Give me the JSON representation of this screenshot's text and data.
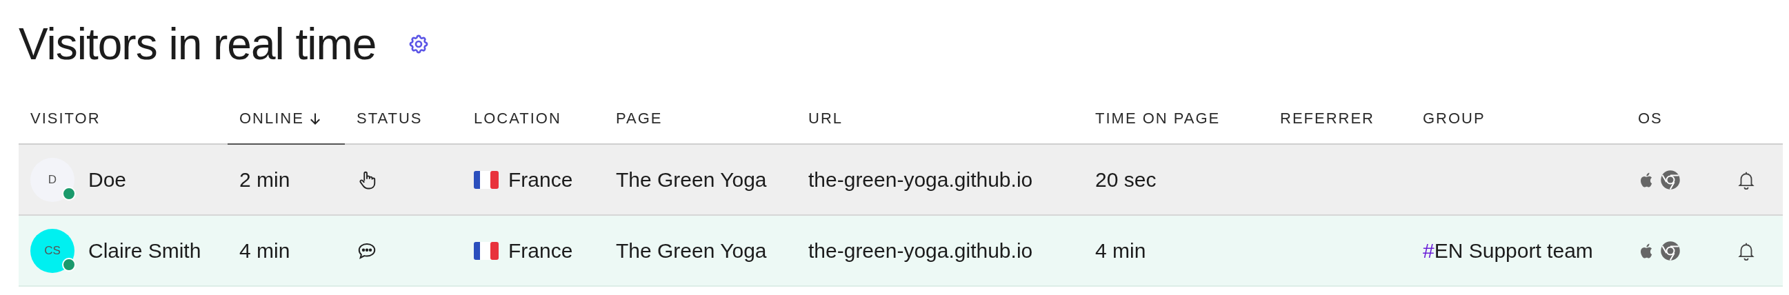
{
  "title": "Visitors in real time",
  "columns": [
    {
      "label": "VISITOR",
      "sorted": false
    },
    {
      "label": "ONLINE",
      "sorted": true
    },
    {
      "label": "STATUS",
      "sorted": false
    },
    {
      "label": "LOCATION",
      "sorted": false
    },
    {
      "label": "PAGE",
      "sorted": false
    },
    {
      "label": "URL",
      "sorted": false
    },
    {
      "label": "TIME ON PAGE",
      "sorted": false
    },
    {
      "label": "REFERRER",
      "sorted": false
    },
    {
      "label": "GROUP",
      "sorted": false
    },
    {
      "label": "OS",
      "sorted": false
    }
  ],
  "rows": [
    {
      "color": "#efefef",
      "avatar": {
        "initials": "D",
        "color": "#f3f4f9"
      },
      "online": true,
      "name": "Doe",
      "online_time": "2 min",
      "status": {
        "kind": "browsing"
      },
      "location": "France",
      "page": "The Green Yoga",
      "url": "the-green-yoga.github.io",
      "time_on_page": "20 sec"
    },
    {
      "color": "#edf9f5",
      "avatar": {
        "initials": "CS",
        "color": "#00f0f0"
      },
      "online": true,
      "name": "Claire Smith",
      "online_time": "4 min",
      "status": {
        "kind": "chatting"
      },
      "location": "France",
      "page": "The Green Yoga",
      "url": "the-green-yoga.github.io",
      "time_on_page": "4 min",
      "group": {
        "hash": "#",
        "name": "EN Support team"
      }
    }
  ]
}
